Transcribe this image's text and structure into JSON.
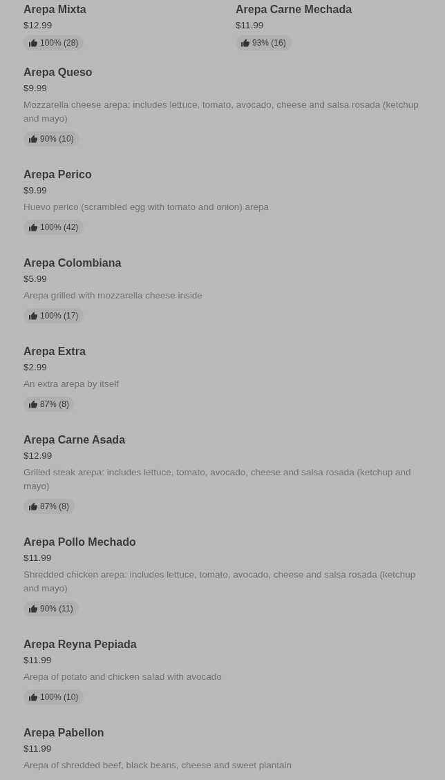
{
  "menu": {
    "grid_items": [
      {
        "name": "Arepa Mixta",
        "price": "$12.99",
        "rating": "100% (28)"
      },
      {
        "name": "Arepa Carne Mechada",
        "price": "$11.99",
        "rating": "93% (16)"
      }
    ],
    "list_items": [
      {
        "name": "Arepa Queso",
        "price": "$9.99",
        "description": "Mozzarella cheese arepa: includes lettuce, tomato, avocado, cheese and salsa rosada (ketchup and mayo)",
        "rating": "90% (10)"
      },
      {
        "name": "Arepa Perico",
        "price": "$9.99",
        "description": "Huevo perico (scrambled egg with tomato and onion) arepa",
        "rating": "100% (42)"
      },
      {
        "name": "Arepa Colombiana",
        "price": "$5.99",
        "description": "Arepa grilled with mozzarella cheese inside",
        "rating": "100% (17)"
      },
      {
        "name": "Arepa Extra",
        "price": "$2.99",
        "description": "An extra arepa by itself",
        "rating": "87% (8)"
      },
      {
        "name": "Arepa Carne Asada",
        "price": "$12.99",
        "description": "Grilled steak arepa: includes lettuce, tomato, avocado, cheese and salsa rosada (ketchup and mayo)",
        "rating": "87% (8)"
      },
      {
        "name": "Arepa Pollo Mechado",
        "price": "$11.99",
        "description": "Shredded chicken arepa: includes lettuce, tomato, avocado, cheese and salsa rosada (ketchup and mayo)",
        "rating": "90% (11)"
      },
      {
        "name": "Arepa Reyna Pepiada",
        "price": "$11.99",
        "description": "Arepa of potato and chicken salad with avocado",
        "rating": "100% (10)"
      },
      {
        "name": "Arepa Pabellon",
        "price": "$11.99",
        "description": "Arepa of shredded beef, black beans, cheese and sweet plantain"
      }
    ]
  }
}
